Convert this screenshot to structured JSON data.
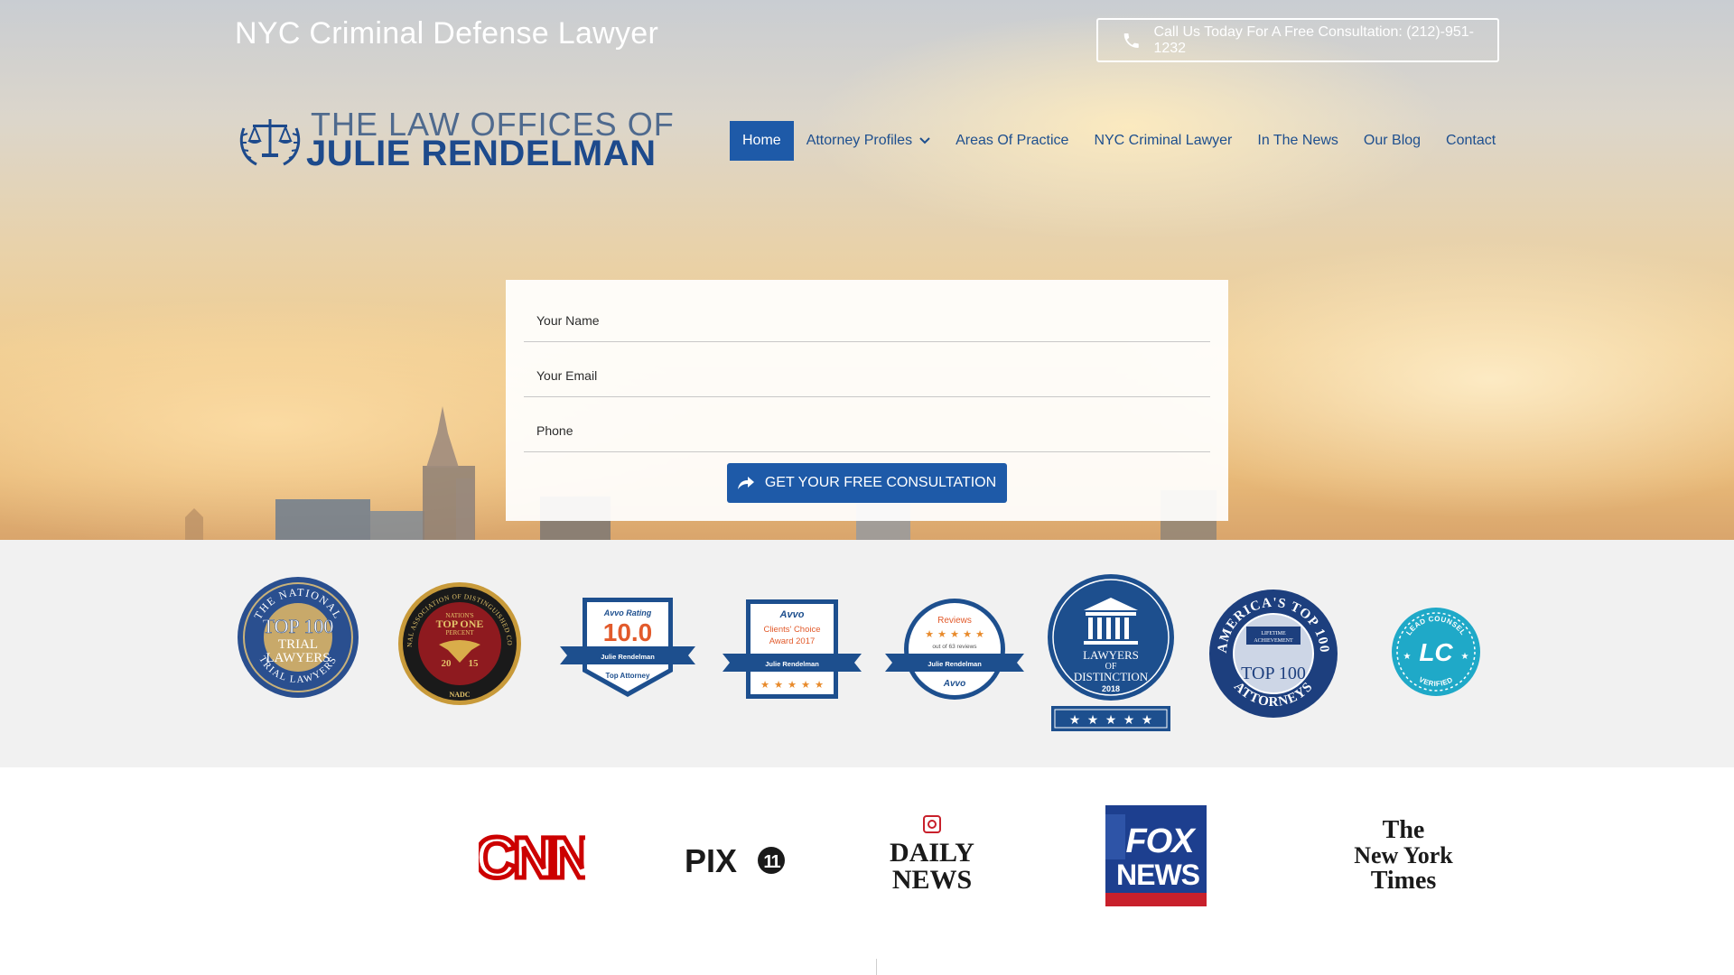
{
  "header": {
    "site_title": "NYC Criminal Defense Lawyer",
    "call_button_label": "Call Us Today For A Free Consultation: (212)-951-1232",
    "logo": {
      "line1": "THE LAW OFFICES OF",
      "line2": "JULIE RENDELMAN"
    }
  },
  "nav": {
    "items": [
      {
        "label": "Home",
        "active": true
      },
      {
        "label": "Attorney Profiles",
        "has_dropdown": true
      },
      {
        "label": "Areas Of Practice"
      },
      {
        "label": "NYC Criminal Lawyer"
      },
      {
        "label": "In The News"
      },
      {
        "label": "Our Blog"
      },
      {
        "label": "Contact"
      }
    ]
  },
  "form": {
    "name_placeholder": "Your Name",
    "email_placeholder": "Your Email",
    "phone_placeholder": "Phone",
    "submit_label": "GET YOUR FREE CONSULTATION"
  },
  "badges": {
    "ntl": {
      "arc_top": "THE NATIONAL",
      "line1": "TOP 100",
      "line2": "TRIAL",
      "line3": "LAWYERS",
      "arc_bottom": "TRIAL LAWYERS"
    },
    "nadc": {
      "arc": "NATIONAL ASSOCIATION OF DISTINGUISHED COUNSEL",
      "line1": "NATION'S",
      "line2": "TOP ONE",
      "line3": "PERCENT",
      "year_left": "20",
      "year_right": "15",
      "footer": "NADC"
    },
    "avvo_rating": {
      "header": "Avvo Rating",
      "score": "10.0",
      "name": "Julie Rendelman",
      "footer": "Top Attorney"
    },
    "avvo_clients": {
      "header": "Avvo",
      "line1": "Clients' Choice",
      "line2": "Award 2017",
      "name": "Julie Rendelman"
    },
    "avvo_reviews": {
      "header": "Reviews",
      "sub": "out of 63 reviews",
      "name": "Julie Rendelman",
      "footer": "Avvo"
    },
    "lod": {
      "line1": "LAWYERS",
      "line2": "OF",
      "line3": "DISTINCTION",
      "year": "2018"
    },
    "americas": {
      "arc_top": "AMERICA'S TOP 100",
      "line1": "LIFETIME",
      "line2": "ACHIEVEMENT",
      "line3": "TOP 100",
      "arc_bottom": "ATTORNEYS"
    },
    "lead": {
      "arc_top": "LEAD COUNSEL",
      "center": "LC",
      "arc_bottom": "VERIFIED"
    }
  },
  "media": {
    "cnn": "CNN",
    "pix": "PIX",
    "pix_num": "11",
    "daily1": "DAILY",
    "daily2": "NEWS",
    "fox1": "FOX",
    "fox2": "NEWS",
    "nyt1": "The",
    "nyt2": "New York",
    "nyt3": "Times"
  },
  "colors": {
    "brand_blue": "#1e5aa8",
    "nav_text": "#1e4f8e",
    "cnn_red": "#cc0000",
    "fox_blue": "#1d3f8f",
    "lead_teal": "#1fa9c8"
  }
}
